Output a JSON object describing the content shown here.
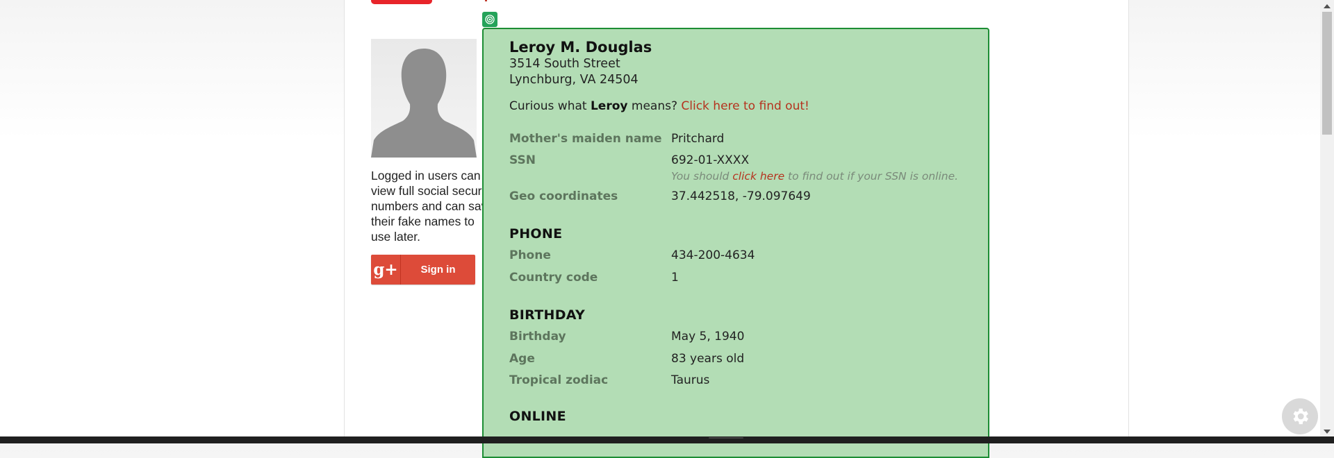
{
  "sidebar": {
    "info_text": "Logged in users can view full social security numbers and can save their fake names to use later.",
    "signin": {
      "icon_text": "g+",
      "label": "Sign in"
    }
  },
  "identity": {
    "name": "Leroy M. Douglas",
    "street": "3514 South Street",
    "city_line": "Lynchburg, VA 24504",
    "curious_prefix": "Curious what ",
    "first_name": "Leroy",
    "curious_mid": " means? ",
    "curious_link": "Click here to find out!"
  },
  "details": {
    "maiden": {
      "label": "Mother's maiden name",
      "value": "Pritchard"
    },
    "ssn": {
      "label": "SSN",
      "value": "692-01-XXXX",
      "note_prefix": "You should ",
      "note_link": "click here",
      "note_suffix": " to find out if your SSN is online."
    },
    "geo": {
      "label": "Geo coordinates",
      "value": "37.442518, -79.097649"
    }
  },
  "phone": {
    "heading": "PHONE",
    "phone": {
      "label": "Phone",
      "value": "434-200-4634"
    },
    "country": {
      "label": "Country code",
      "value": "1"
    }
  },
  "birthday": {
    "heading": "BIRTHDAY",
    "birthday": {
      "label": "Birthday",
      "value": "May 5, 1940"
    },
    "age": {
      "label": "Age",
      "value": "83 years old"
    },
    "zodiac": {
      "label": "Tropical zodiac",
      "value": "Taurus"
    }
  },
  "online": {
    "heading": "ONLINE"
  },
  "icons": {
    "target": "target-icon",
    "gear": "gear-icon"
  },
  "colors": {
    "overlay": "#b3ddb5",
    "overlay_border": "#1c8d34",
    "link": "#b5321e",
    "signin": "#dd4b39"
  }
}
